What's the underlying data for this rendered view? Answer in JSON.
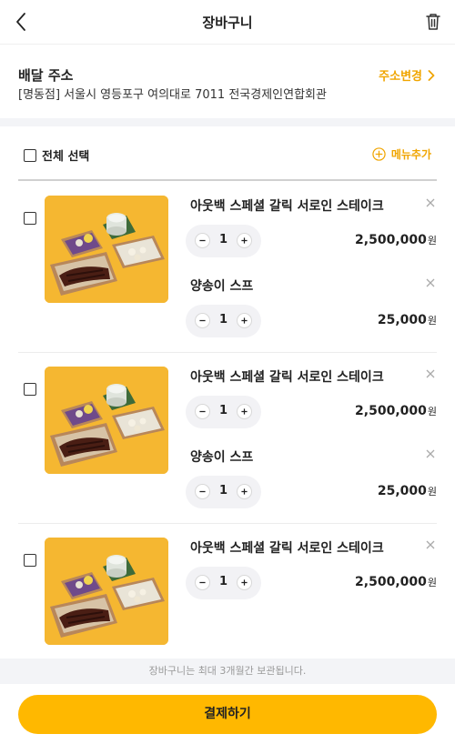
{
  "header": {
    "title": "장바구니",
    "back_icon": "chevron-left-icon",
    "trash_icon": "trash-icon"
  },
  "address": {
    "label": "배달 주소",
    "text": "[명동점] 서울시 영등포구 여의대로 7011 전국경제인연합회관",
    "change_label": "주소변경"
  },
  "selection": {
    "select_all_label": "전체 선택",
    "add_menu_label": "메뉴추가"
  },
  "cart": {
    "groups": [
      {
        "main": {
          "name": "아웃백 스페셜 갈릭 서로인 스테이크",
          "qty": "1",
          "price": "2,500,000",
          "unit": "원"
        },
        "side": {
          "name": "양송이 스프",
          "qty": "1",
          "price": "25,000",
          "unit": "원"
        }
      },
      {
        "main": {
          "name": "아웃백 스페셜 갈릭 서로인 스테이크",
          "qty": "1",
          "price": "2,500,000",
          "unit": "원"
        },
        "side": {
          "name": "양송이 스프",
          "qty": "1",
          "price": "25,000",
          "unit": "원"
        }
      },
      {
        "main": {
          "name": "아웃백 스페셜 갈릭 서로인 스테이크",
          "qty": "1",
          "price": "2,500,000",
          "unit": "원"
        }
      }
    ]
  },
  "notice": "장바구니는 최대 3개월간 보관됩니다.",
  "pay_button_label": "결제하기",
  "colors": {
    "accent": "#ffb800",
    "accent_text": "#f0a500",
    "food_bg": "#f5b731"
  }
}
